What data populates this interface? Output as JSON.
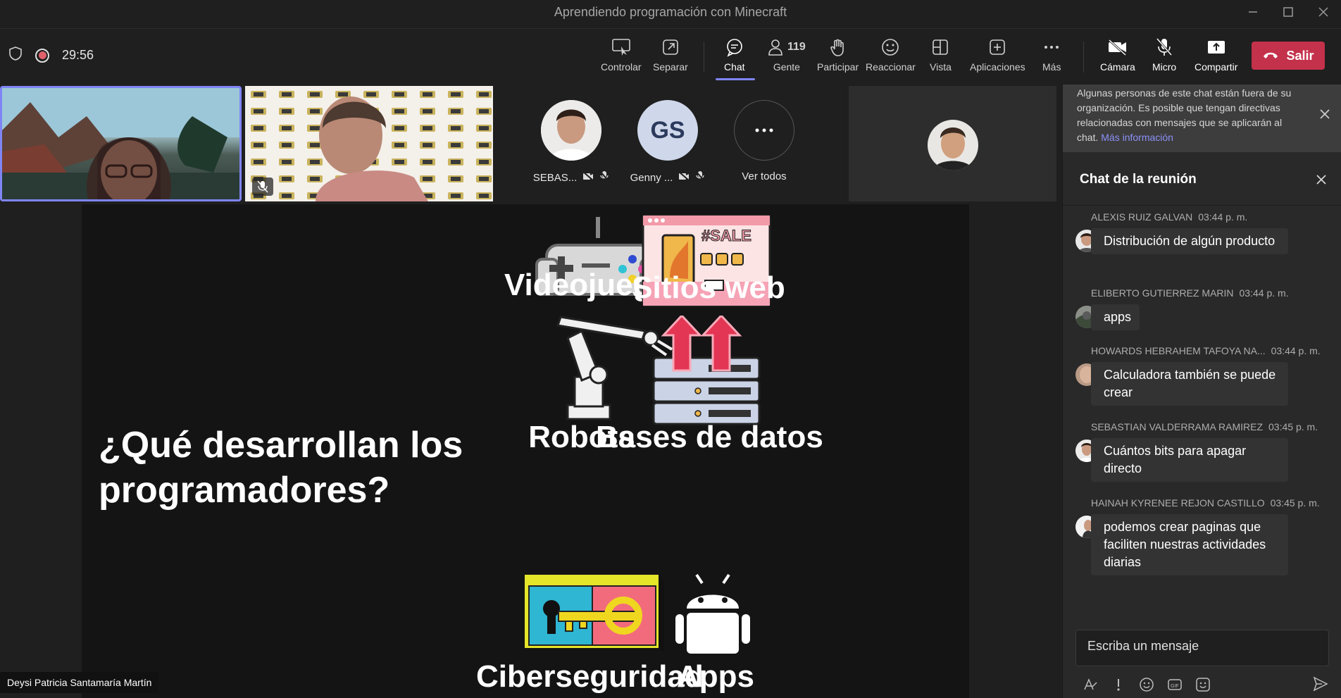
{
  "window": {
    "title": "Aprendiendo programación con Minecraft"
  },
  "toolbar": {
    "timer": "29:56",
    "controlar": "Controlar",
    "separar": "Separar",
    "chat": "Chat",
    "gente": "Gente",
    "people_count": "119",
    "participar": "Participar",
    "reaccionar": "Reaccionar",
    "vista": "Vista",
    "aplicaciones": "Aplicaciones",
    "mas": "Más",
    "camara": "Cámara",
    "micro": "Micro",
    "compartir": "Compartir",
    "salir": "Salir"
  },
  "participants": {
    "p1_name": "SEBAS...",
    "p2_initials": "GS",
    "p2_name": "Genny ...",
    "see_all": "Ver todos"
  },
  "slide": {
    "heading": "¿Qué desarrollan los programadores?",
    "items": [
      "Videojuegos",
      "Sitios web",
      "Robots",
      "Bases de datos",
      "Ciberseguridad",
      "Apps"
    ],
    "sale_text": "#SALE"
  },
  "presenter_name": "Deysi Patricia Santamaría Martín",
  "chat": {
    "notice": "Algunas personas de este chat están fuera de su organización. Es posible que tengan directivas relacionadas con mensajes que se aplicarán al chat.",
    "notice_link": "Más información",
    "title": "Chat de la reunión",
    "messages": [
      {
        "author": "ALEXIS RUIZ GALVAN",
        "time": "03:44 p. m.",
        "text": "Distribución de algún producto"
      },
      {
        "author": "ELIBERTO GUTIERREZ MARIN",
        "time": "03:44 p. m.",
        "text": "apps"
      },
      {
        "author": "HOWARDS HEBRAHEM TAFOYA NA...",
        "time": "03:44 p. m.",
        "text": "Calculadora también se puede crear"
      },
      {
        "author": "SEBASTIAN VALDERRAMA RAMIREZ",
        "time": "03:45 p. m.",
        "text": "Cuántos bits para apagar directo"
      },
      {
        "author": "HAINAH KYRENEE REJON CASTILLO",
        "time": "03:45 p. m.",
        "text": "podemos crear paginas que faciliten nuestras actividades diarias"
      }
    ],
    "compose_placeholder": "Escriba un mensaje"
  },
  "colors": {
    "accent": "#7f85f5",
    "leave": "#c4314b",
    "panel": "#292929",
    "background": "#1f1f1f"
  }
}
